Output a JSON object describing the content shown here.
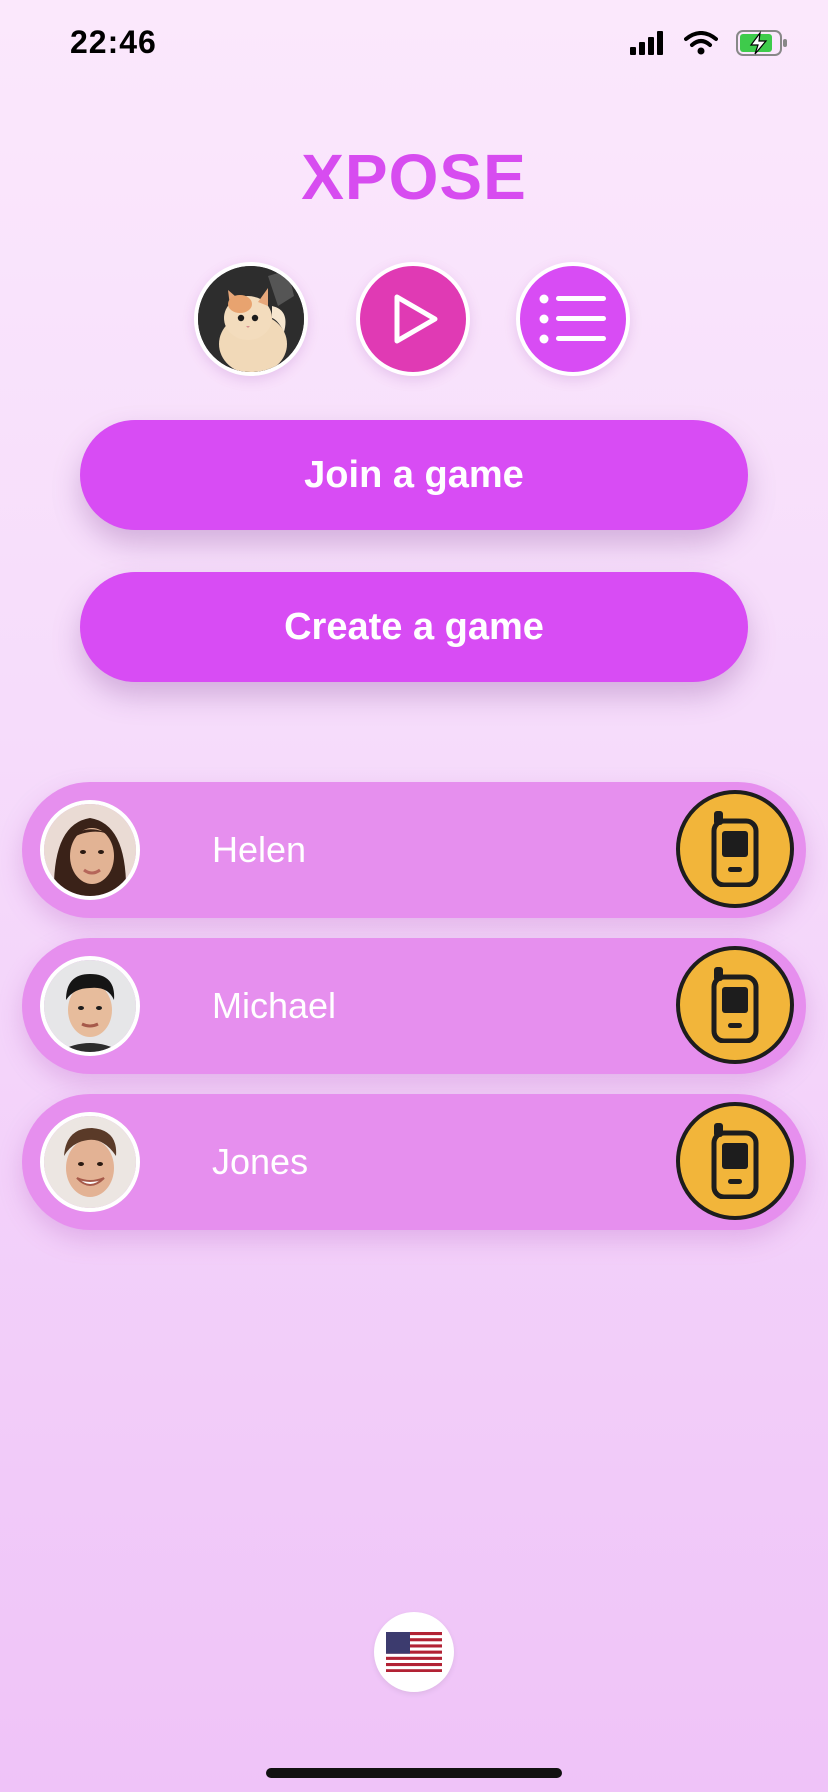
{
  "status_bar": {
    "time": "22:46"
  },
  "app": {
    "title": "XPOSE"
  },
  "top_actions": {
    "profile_icon": "cat-avatar",
    "play_icon": "play-icon",
    "menu_icon": "list-icon"
  },
  "buttons": {
    "join": "Join a game",
    "create": "Create a game"
  },
  "friends": [
    {
      "name": "Helen",
      "avatar": "woman-avatar",
      "action_icon": "phone-icon"
    },
    {
      "name": "Michael",
      "avatar": "man-avatar",
      "action_icon": "phone-icon"
    },
    {
      "name": "Jones",
      "avatar": "man-smile-avatar",
      "action_icon": "phone-icon"
    }
  ],
  "language": {
    "icon": "us-flag-icon"
  },
  "colors": {
    "accent": "#d84cf4",
    "title": "#d74cf0",
    "play_button": "#e03ab4",
    "row": "#e68fee",
    "call_button": "#f2b53a"
  }
}
